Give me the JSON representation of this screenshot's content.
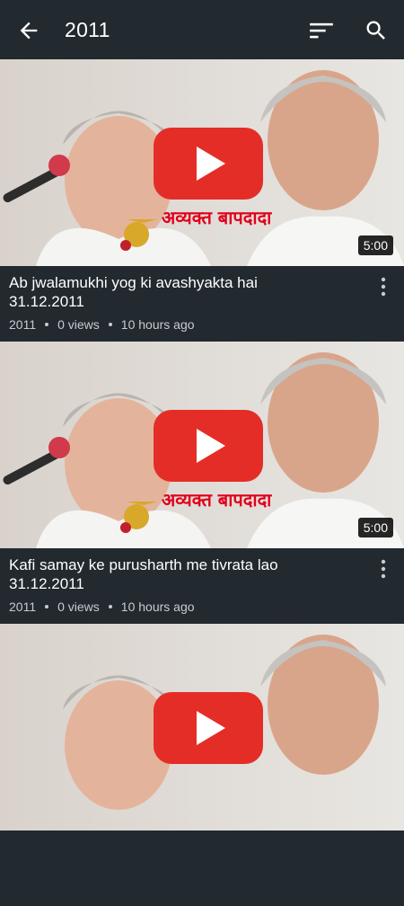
{
  "appbar": {
    "title": "2011"
  },
  "videos": [
    {
      "title_line1": "Ab jwalamukhi yog ki avashyakta hai",
      "title_line2": "31.12.2011",
      "channel": "2011",
      "views": "0 views",
      "age": "10 hours ago",
      "duration": "5:00",
      "thumb_caption": "अव्यक्त बापदादा"
    },
    {
      "title_line1": "Kafi samay ke purusharth me tivrata lao",
      "title_line2": "31.12.2011",
      "channel": "2011",
      "views": "0 views",
      "age": "10 hours ago",
      "duration": "5:00",
      "thumb_caption": "अव्यक्त बापदादा"
    },
    {
      "title_line1": "",
      "title_line2": "",
      "channel": "",
      "views": "",
      "age": "",
      "duration": "",
      "thumb_caption": ""
    }
  ],
  "colors": {
    "appbar": "#22292f",
    "play_red": "#e52d27",
    "caption_red": "#e0001a"
  }
}
